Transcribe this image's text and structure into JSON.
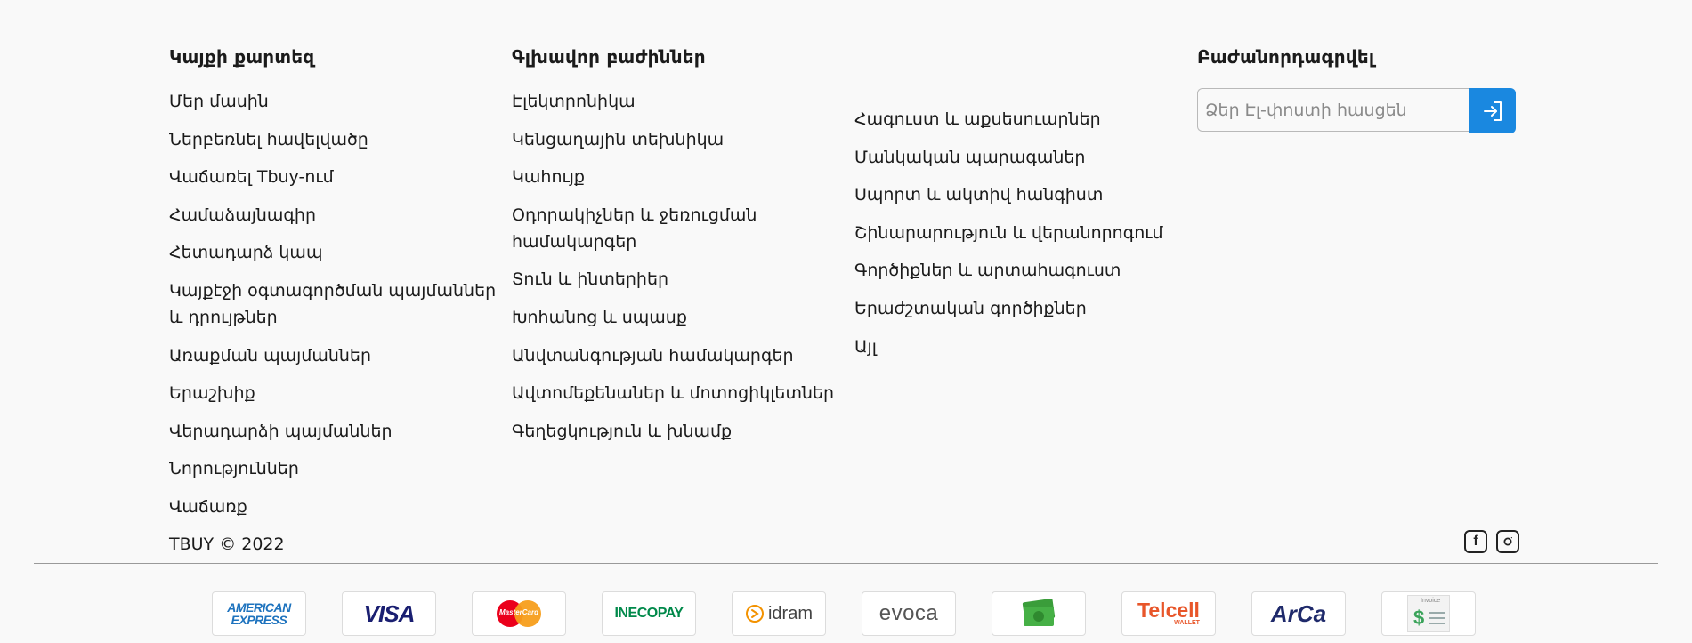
{
  "sitemap": {
    "title": "Կայքի քարտեզ",
    "items": [
      "Մեր մասին",
      "Ներբեռնել հավելվածը",
      "Վաճառել Tbuy-ում",
      "Համաձայնագիր",
      "Հետադարձ կապ",
      "Կայքէջի օգտագործման պայմաններ և դրույթներ",
      "Առաքման պայմաններ",
      "Երաշխիք",
      "Վերադարձի պայմաններ",
      "Նորություններ",
      "Վաճառք"
    ]
  },
  "main_sections": {
    "title": "Գլխավոր բաժիններ",
    "items": [
      "Էլեկտրոնիկա",
      "Կենցաղային տեխնիկա",
      "Կահույք",
      "Օդորակիչներ և ջեռուցման համակարգեր",
      "Տուն և ինտերիեր",
      "Խոհանոց և սպասք",
      "Անվտանգության համակարգեր",
      "Ավտոմեքենաներ և մոտոցիկլետներ",
      "Գեղեցկություն և խնամք"
    ]
  },
  "more_sections": {
    "items": [
      "Հագուստ և աքսեսուարներ",
      "Մանկական պարագաներ",
      "Սպորտ և ակտիվ հանգիստ",
      "Շինարարություն և վերանորոգում",
      "Գործիքներ և արտահագուստ",
      "Երաժշտական գործիքներ",
      "Այլ"
    ]
  },
  "subscribe": {
    "title": "Բաժանորդագրվել",
    "placeholder": "Ձեր Էլ-փոստի հասցեն",
    "button_icon": "login-arrow-icon"
  },
  "copyright": "TBUY © 2022",
  "social": {
    "facebook_label": "f",
    "icons": [
      "facebook-icon",
      "instagram-icon"
    ]
  },
  "payments": {
    "amex_line1": "AMERICAN",
    "amex_line2": "EXPRESS",
    "visa": "VISA",
    "mastercard": "MasterCard",
    "inecopay": "INECOPAY",
    "idram": "idram",
    "evoca": "evoca",
    "telcell": "Telcell",
    "telcell_sub": "WALLET",
    "arca": "ArCa",
    "invoice": "Invoice",
    "invoice_symbol": "$"
  },
  "colors": {
    "accent": "#1a88e0",
    "background": "#f9f9f9",
    "telcell": "#e8562a",
    "arca": "#1f2a6b",
    "visa": "#1a1f71",
    "ineco_green": "#00894a"
  }
}
